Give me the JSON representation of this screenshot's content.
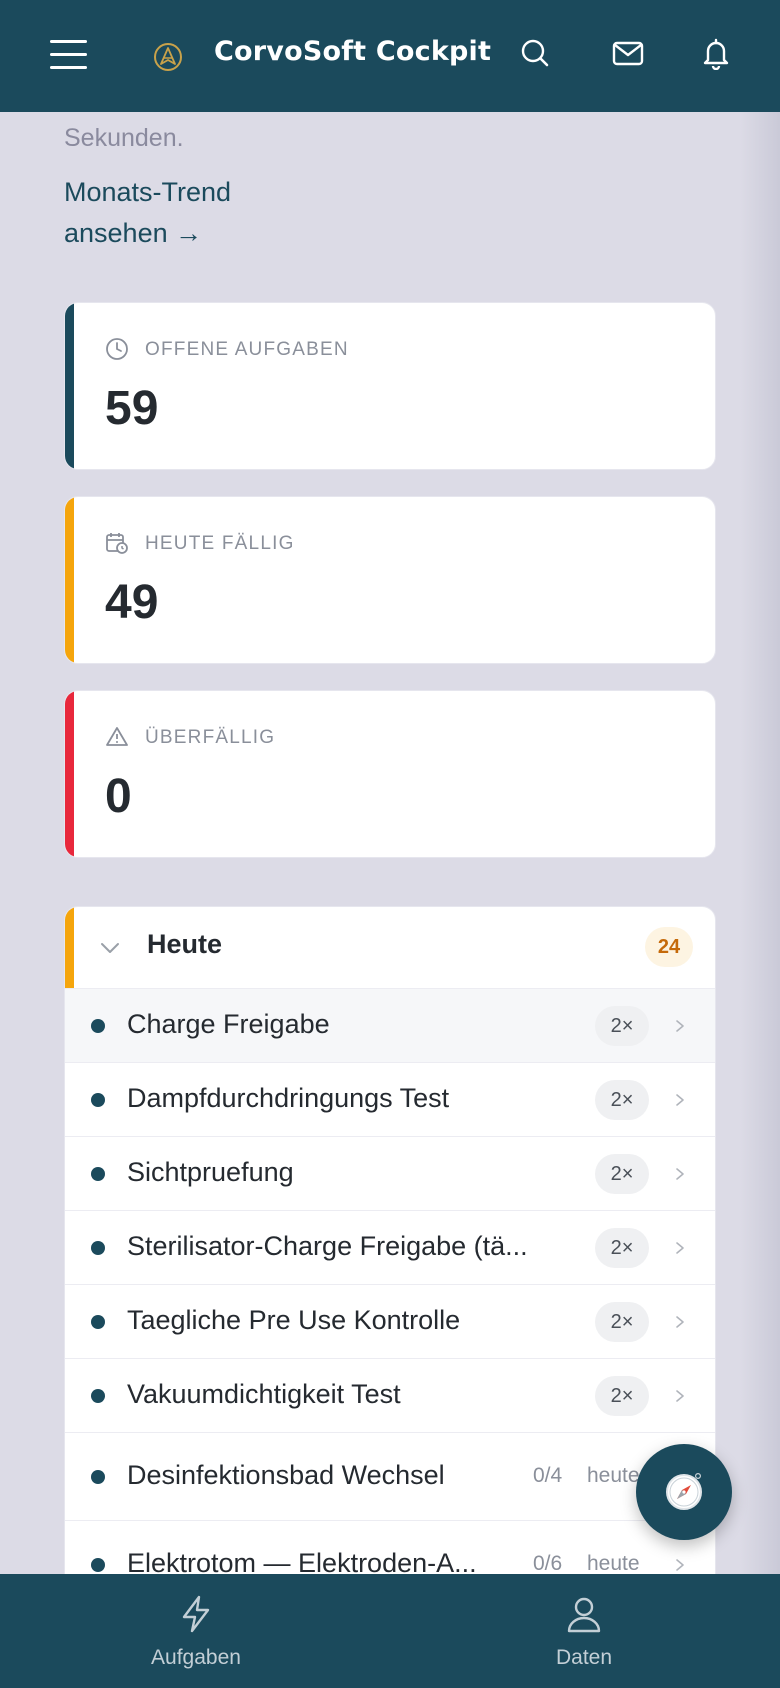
{
  "header": {
    "title": "CorvoSoft Cockpit",
    "menu_icon": "hamburger-menu-icon",
    "logo_icon": "corvosoft-logo-icon",
    "actions": [
      "search-icon",
      "mail-icon",
      "bell-icon"
    ]
  },
  "intro": {
    "text": "Sekunden.",
    "trend_link": "Monats-Trend ansehen →"
  },
  "stats": [
    {
      "label": "OFFENE AUFGABEN",
      "value": "59",
      "icon": "clock-icon",
      "accent": "#1b4a5c"
    },
    {
      "label": "HEUTE FÄLLIG",
      "value": "49",
      "icon": "calendar-clock-icon",
      "accent": "#f5a50c"
    },
    {
      "label": "ÜBERFÄLLIG",
      "value": "0",
      "icon": "warning-triangle-icon",
      "accent": "#e8283c"
    }
  ],
  "today_list": {
    "title": "Heute",
    "count": "24",
    "accent": "#f5a50c",
    "items": [
      {
        "name": "Charge Freigabe",
        "times": "2×"
      },
      {
        "name": "Dampfdurchdringungs Test",
        "times": "2×"
      },
      {
        "name": "Sichtpruefung",
        "times": "2×"
      },
      {
        "name": "Sterilisator-Charge Freigabe (tä...",
        "times": "2×"
      },
      {
        "name": "Taegliche Pre Use Kontrolle",
        "times": "2×"
      },
      {
        "name": "Vakuumdichtigkeit Test",
        "times": "2×"
      },
      {
        "name": "Desinfektionsbad Wechsel",
        "progress": "0/4",
        "due": "heute"
      },
      {
        "name": "Elektrotom — Elektroden-A...",
        "progress": "0/6",
        "due": "heute"
      }
    ]
  },
  "fab": {
    "icon": "compass-icon"
  },
  "bottom_nav": [
    {
      "label": "Aufgaben",
      "icon": "lightning-icon"
    },
    {
      "label": "Daten",
      "icon": "person-icon"
    }
  ]
}
